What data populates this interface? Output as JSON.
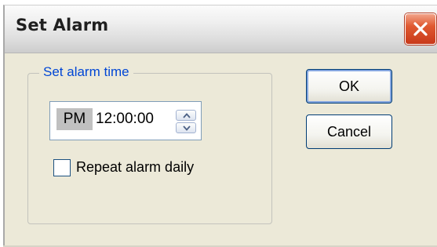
{
  "window": {
    "title": "Set Alarm"
  },
  "alarm_group": {
    "legend": "Set alarm time",
    "time_picker": {
      "ampm": "PM",
      "time": "12:00:00"
    },
    "repeat_checkbox": {
      "label": "Repeat alarm daily",
      "checked": false
    }
  },
  "buttons": {
    "ok": "OK",
    "cancel": "Cancel"
  },
  "icons": {
    "close": "close-icon",
    "spin_up": "chevron-up-icon",
    "spin_down": "chevron-down-icon"
  },
  "colors": {
    "dialog_bg": "#ece9d8",
    "legend_text": "#0046d5",
    "close_button": "#e05a31"
  }
}
